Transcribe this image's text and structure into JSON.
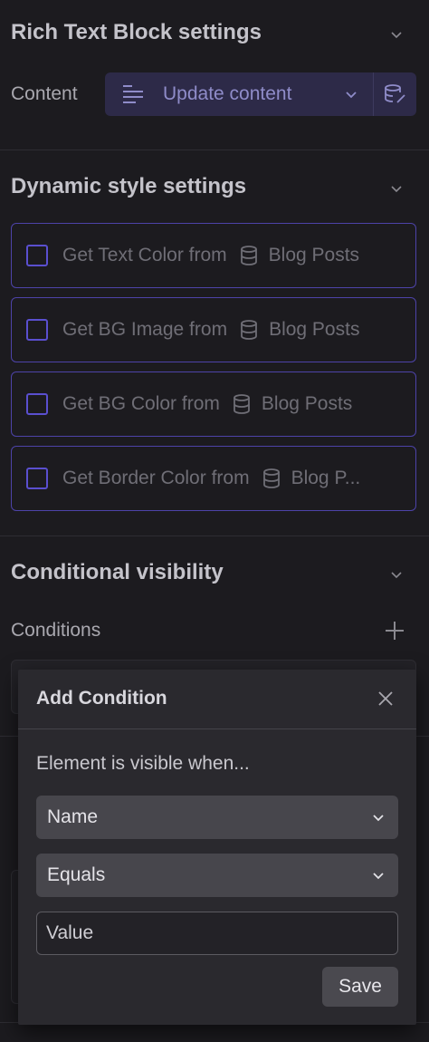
{
  "rich_text": {
    "title": "Rich Text Block settings",
    "content_label": "Content",
    "update_button": "Update content"
  },
  "dynamic": {
    "title": "Dynamic style settings",
    "items": [
      {
        "label": "Get Text Color from",
        "source": "Blog Posts"
      },
      {
        "label": "Get BG Image from",
        "source": "Blog Posts"
      },
      {
        "label": "Get BG Color from",
        "source": "Blog Posts"
      },
      {
        "label": "Get Border Color from",
        "source": "Blog P..."
      }
    ]
  },
  "visibility": {
    "title": "Conditional visibility",
    "conditions_label": "Conditions"
  },
  "modal": {
    "title": "Add Condition",
    "subtitle": "Element is visible when...",
    "field_select": "Name",
    "operator_select": "Equals",
    "value_placeholder": "Value",
    "save_label": "Save"
  },
  "colors": {
    "accent_border": "#4d43a8",
    "button_bg": "#2d2a48",
    "panel_bg": "#1c1b1f"
  }
}
